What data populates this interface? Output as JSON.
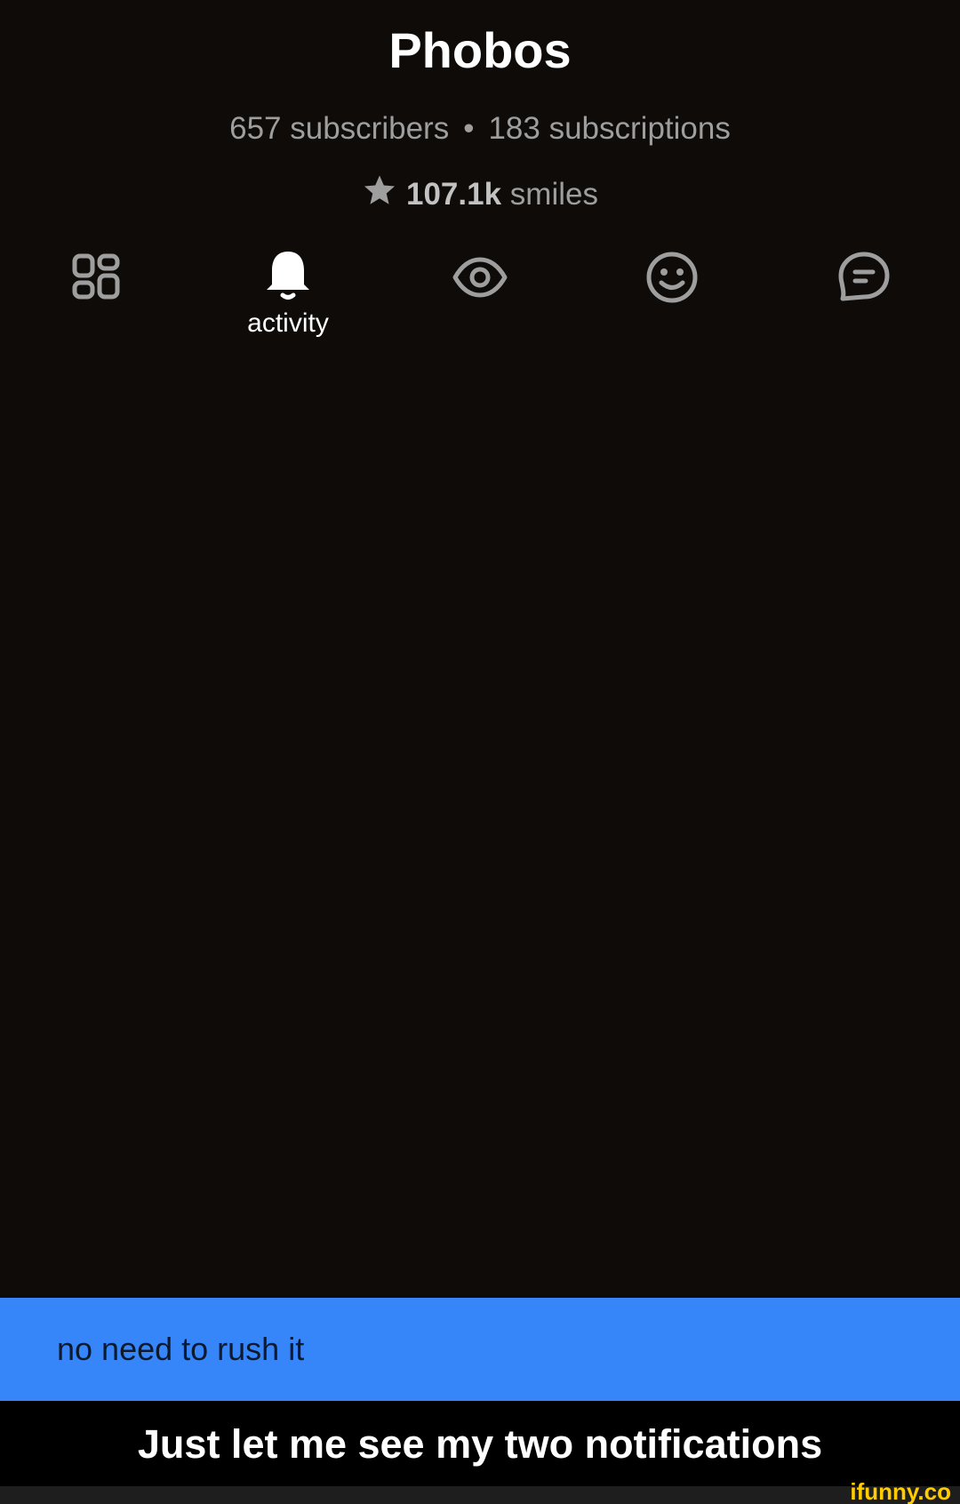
{
  "profile": {
    "username": "Phobos",
    "subscribers": "657 subscribers",
    "separator": "•",
    "subscriptions": "183 subscriptions",
    "smiles_count": "107.1k",
    "smiles_label": "smiles"
  },
  "tabs": [
    {
      "icon": "grid-icon",
      "label": ""
    },
    {
      "icon": "bell-icon",
      "label": "activity",
      "active": true
    },
    {
      "icon": "eye-icon",
      "label": ""
    },
    {
      "icon": "smiley-icon",
      "label": ""
    },
    {
      "icon": "chat-icon",
      "label": ""
    }
  ],
  "banner": {
    "text": "no need to rush it",
    "color": "#3685f9"
  },
  "caption": {
    "text": "Just let me see my two notifications"
  },
  "watermark": {
    "text": "ifunny.co"
  },
  "colors": {
    "background": "#0e0b09",
    "muted_text": "#9e9e9e",
    "active_icon": "#ffffff",
    "watermark": "#ffcc00"
  }
}
